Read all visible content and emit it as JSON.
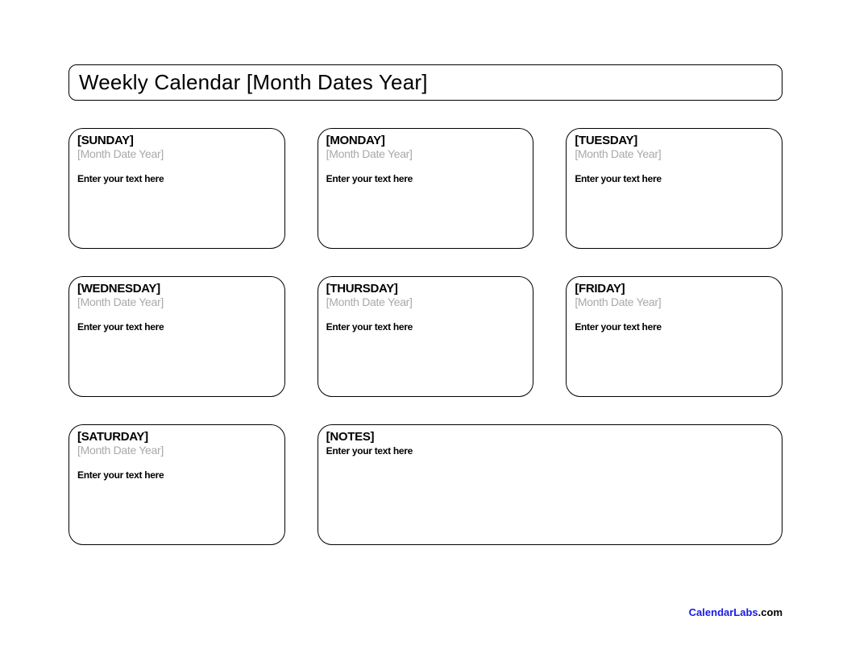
{
  "header": {
    "title": "Weekly Calendar [Month Dates Year]"
  },
  "days": [
    {
      "name": "[SUNDAY]",
      "date": "[Month Date Year]",
      "placeholder": "Enter your text here"
    },
    {
      "name": "[MONDAY]",
      "date": "[Month Date Year]",
      "placeholder": "Enter your text here"
    },
    {
      "name": "[TUESDAY]",
      "date": "[Month Date Year]",
      "placeholder": "Enter your text here"
    },
    {
      "name": "[WEDNESDAY]",
      "date": "[Month Date Year]",
      "placeholder": "Enter your text here"
    },
    {
      "name": "[THURSDAY]",
      "date": "[Month Date Year]",
      "placeholder": "Enter your text here"
    },
    {
      "name": "[FRIDAY]",
      "date": "[Month Date Year]",
      "placeholder": "Enter your text here"
    },
    {
      "name": "[SATURDAY]",
      "date": "[Month Date Year]",
      "placeholder": "Enter your text here"
    }
  ],
  "notes": {
    "name": "[NOTES]",
    "placeholder": "Enter your text here"
  },
  "footer": {
    "brand": "CalendarLabs",
    "suffix": ".com"
  }
}
